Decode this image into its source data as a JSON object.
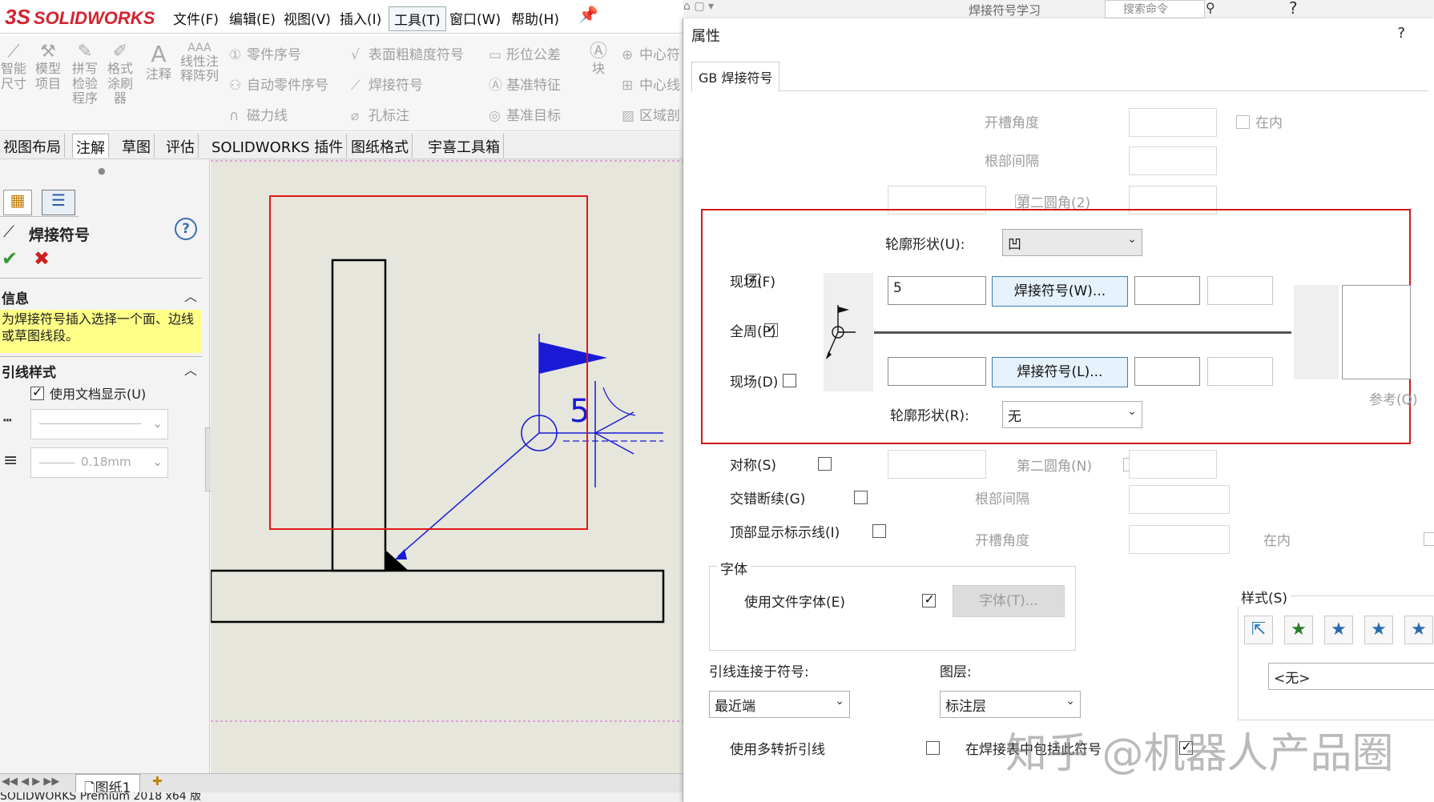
{
  "app": {
    "brand_prefix": "3S",
    "brand": "SOLIDWORKS",
    "status": "SOLIDWORKS Premium 2018 x64 版"
  },
  "menu": [
    "文件(F)",
    "编辑(E)",
    "视图(V)",
    "插入(I)",
    "工具(T)",
    "窗口(W)",
    "帮助(H)"
  ],
  "quickaccess": {
    "title_fragment": "焊接符号学习",
    "search_placeholder": "搜索命令",
    "help": "?"
  },
  "ribbon": {
    "big": [
      {
        "label": "智能尺寸",
        "icon": "smart-dimension-icon"
      },
      {
        "label": "模型项目",
        "icon": "model-items-icon"
      },
      {
        "label": "拼写检验程序",
        "icon": "spell-check-icon"
      },
      {
        "label": "格式涂刷器",
        "icon": "format-painter-icon"
      },
      {
        "label": "注释",
        "icon": "note-icon"
      },
      {
        "label": "线性注释阵列",
        "icon": "linear-note-pattern-icon"
      }
    ],
    "col1": [
      "零件序号",
      "自动零件序号",
      "磁力线"
    ],
    "col2": [
      "表面粗糙度符号",
      "焊接符号",
      "孔标注"
    ],
    "col3": [
      "形位公差",
      "基准特征",
      "基准目标"
    ],
    "block": "块",
    "col4": [
      "中心符",
      "中心线",
      "区域剖"
    ]
  },
  "tabs": [
    "视图布局",
    "注解",
    "草图",
    "评估",
    "SOLIDWORKS 插件",
    "图纸格式",
    "宇喜工具箱"
  ],
  "leftpane": {
    "title": "焊接符号",
    "help": "?",
    "info_header": "信息",
    "info_text": "为焊接符号插入选择一个面、边线或草图线段。",
    "leader_header": "引线样式",
    "use_doc_display": "使用文档显示(U)",
    "line_weight": "0.18mm"
  },
  "canvas": {
    "weld_size": "5"
  },
  "sheet": {
    "name": "图纸1"
  },
  "dialog": {
    "title": "属性",
    "help": "?",
    "tab": "GB 焊接符号",
    "groove_angle": "开槽角度",
    "inside": "在内",
    "root_gap": "根部间隔",
    "second_fillet_2": "第二圆角(2)",
    "contour_u": "轮廓形状(U):",
    "contour_u_value": "凹",
    "field_f": "现场(F)",
    "all_around": "全周(P)",
    "field_d": "现场(D)",
    "upper_size": "5",
    "weld_w": "焊接符号(W)...",
    "weld_l": "焊接符号(L)...",
    "contour_r": "轮廓形状(R):",
    "contour_r_value": "无",
    "reference": "参考(Q)",
    "symmetric": "对称(S)",
    "second_fillet_n": "第二圆角(N)",
    "staggered": "交错断续(G)",
    "root_gap_2": "根部间隔",
    "top_id_line": "顶部显示标示线(I)",
    "groove_angle_2": "开槽角度",
    "inside_2": "在内",
    "font_group": "字体",
    "use_doc_font": "使用文件字体(E)",
    "font_btn": "字体(T)...",
    "style": "样式(S)",
    "style_value": "<无>",
    "leader_anchor": "引线连接于符号:",
    "leader_anchor_value": "最近端",
    "layer": "图层:",
    "layer_value": "标注层",
    "multi_jog": "使用多转折引线",
    "include_in_weld": "在焊接表中包括此符号"
  },
  "watermark": "知乎 @机器人产品圈",
  "colors": {
    "brand_red": "#d3232f",
    "annotation_blue": "#1a1ad6",
    "highlight_red": "#d01a1a",
    "info_yellow": "#ffff88",
    "check_green": "#2e9b2e"
  }
}
